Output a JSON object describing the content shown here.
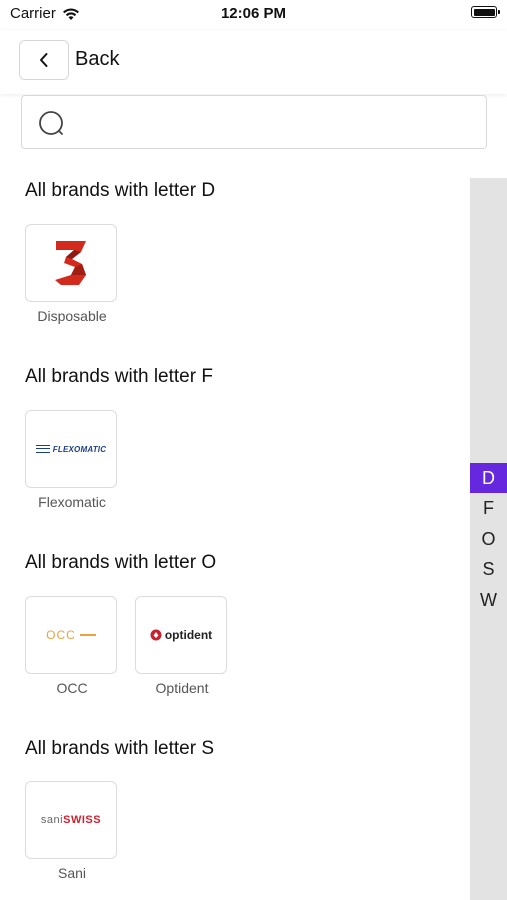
{
  "status_bar": {
    "carrier": "Carrier",
    "time": "12:06 PM"
  },
  "nav": {
    "back_label": "Back"
  },
  "search": {
    "placeholder": ""
  },
  "sections": [
    {
      "title": "All brands with letter D",
      "brands": [
        {
          "name": "Disposable",
          "logo": "disposable-3-logo"
        }
      ]
    },
    {
      "title": "All brands with letter F",
      "brands": [
        {
          "name": "Flexomatic",
          "logo_text": "FLEXOMATIC"
        }
      ]
    },
    {
      "title": "All brands with letter O",
      "brands": [
        {
          "name": "OCC",
          "logo_text": "OCC"
        },
        {
          "name": "Optident",
          "logo_text": "optident"
        }
      ]
    },
    {
      "title": "All brands with letter S",
      "brands": [
        {
          "name": "Sani",
          "logo_text_a": "sani",
          "logo_text_b": "SWISS"
        }
      ]
    }
  ],
  "index": {
    "letters": [
      "D",
      "F",
      "O",
      "S",
      "W"
    ],
    "active": "D"
  },
  "colors": {
    "accent": "#6528de",
    "disposable_red": "#d32a1e",
    "flexomatic_blue": "#1b3e8a",
    "occ_orange": "#e9a23b",
    "sani_red": "#d1202f"
  }
}
